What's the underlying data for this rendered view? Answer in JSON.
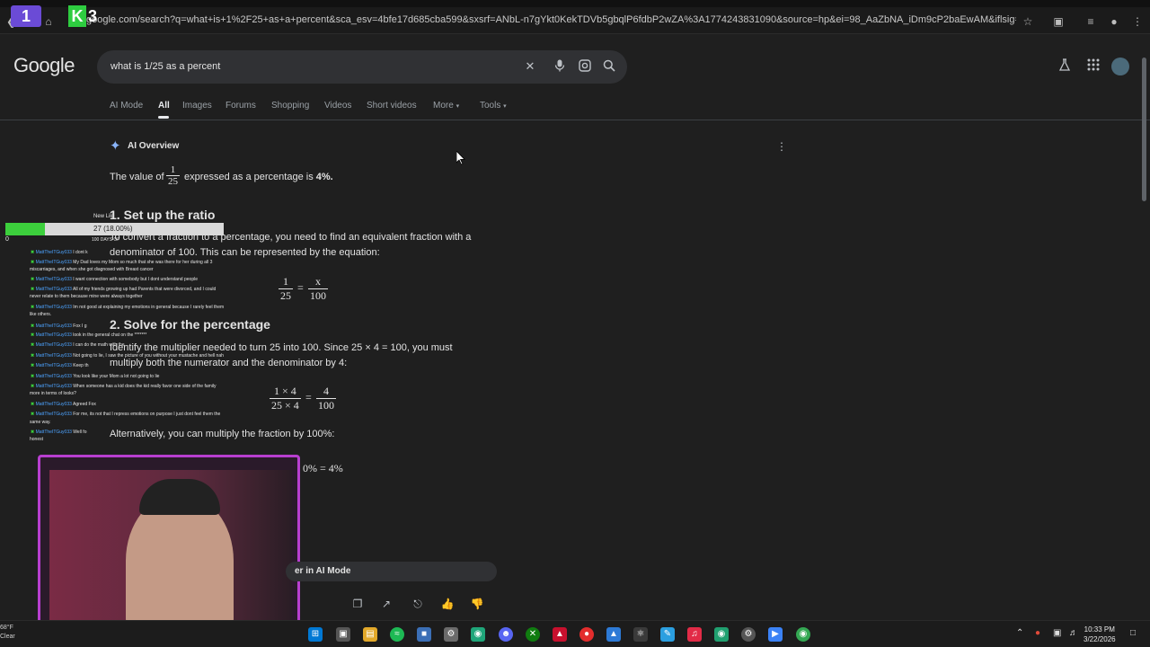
{
  "browser": {
    "url": "google.com/search?q=what+is+1%2F25+as+a+percent&sca_esv=4bfe17d685cba599&sxsrf=ANbL-n7gYkt0KekTDVb5gbqlP6fdbP2wZA%3A1774243831090&source=hp&ei=98_AaZbNA_iDm9cP2baEwAM&iflsig=AFdpzrgAAAAAacDeB4jg3VN..."
  },
  "overlay": {
    "badge_one": "1",
    "badge_three": "3"
  },
  "google": {
    "logo": "Google",
    "query": "what is 1/25 as a percent",
    "tabs": [
      {
        "label": "AI Mode"
      },
      {
        "label": "All"
      },
      {
        "label": "Images"
      },
      {
        "label": "Forums"
      },
      {
        "label": "Shopping"
      },
      {
        "label": "Videos"
      },
      {
        "label": "Short videos"
      },
      {
        "label": "More"
      },
      {
        "label": "Tools"
      }
    ]
  },
  "ai_overview": {
    "title": "AI Overview",
    "intro_before": "The value of",
    "intro_frac_num": "1",
    "intro_frac_den": "25",
    "intro_after": "expressed as a percentage is",
    "intro_result": "4%.",
    "step1_heading": "1. Set up the ratio",
    "step1_text_a": "To convert a fraction to a percentage, you need to find an equivalent fraction with a",
    "step1_text_b": "denominator of 100. This can be represented by the equation:",
    "eq1_left_num": "1",
    "eq1_left_den": "25",
    "eq1_eq": "=",
    "eq1_right_num": "x",
    "eq1_right_den": "100",
    "step2_heading": "2. Solve for the percentage",
    "step2_text_a": "Identify the multiplier needed to turn 25 into 100. Since 25 × 4 = 100, you must",
    "step2_text_b": "multiply both the numerator and the denominator by 4:",
    "eq2_left_num": "1 × 4",
    "eq2_left_den": "25 × 4",
    "eq2_eq": "=",
    "eq2_right_num": "4",
    "eq2_right_den": "100",
    "alt_text": "Alternatively, you can multiply the fraction by 100%:",
    "alt_eq": "0% = 4%",
    "ai_mode_label": "er in AI Mode"
  },
  "chat": {
    "bar_label_top": "New Lik",
    "bar_value_label": "27 (18.00%)",
    "bar_fraction": 0.18,
    "bar_min": "0",
    "bar_sub": "100 DAYS OF",
    "lines": [
      {
        "user": "MattTheITGuy033",
        "text": "I dont k"
      },
      {
        "user": "MattTheITGuy033",
        "text": "My Dad loves my Mom so much that she was there for her during all 3"
      },
      {
        "user": "",
        "text": "miscarriages, and when she got diagnosed with Breast cancer"
      },
      {
        "user": "MattTheITGuy033",
        "text": "I want connection with somebody but I dont understand people"
      },
      {
        "user": "MattTheITGuy033",
        "text": "All of my friends growing up had Parents that were divorced, and I could"
      },
      {
        "user": "",
        "text": "never relate to them because mine were always together"
      },
      {
        "user": "MattTheITGuy033",
        "text": "Im not good at explaining my emotions in general because I rarely feel them"
      },
      {
        "user": "",
        "text": "like others."
      },
      {
        "user": "MattTheITGuy033",
        "text": "Fox I g"
      },
      {
        "user": "MattTheITGuy033",
        "text": "look in the general chat on the *******"
      },
      {
        "user": "MattTheITGuy033",
        "text": "I can do the math with the"
      },
      {
        "user": "MattTheITGuy033",
        "text": "Not going to lie, I saw the picture of you without your mustache and hell nah"
      },
      {
        "user": "MattTheITGuy033",
        "text": "Keep th"
      },
      {
        "user": "MattTheITGuy033",
        "text": "You look like your Mom a lot not going to lie"
      },
      {
        "user": "MattTheITGuy033",
        "text": "When someone has a kid does the kid really favor one side of the family"
      },
      {
        "user": "",
        "text": "more in terms of looks?"
      },
      {
        "user": "MattTheITGuy033",
        "text": "Agreed Fox"
      },
      {
        "user": "MattTheITGuy033",
        "text": "For me, its not that I repress emotions on purpose I just dont feel them the"
      },
      {
        "user": "",
        "text": "same way."
      },
      {
        "user": "MattTheITGuy033",
        "text": "Well fo"
      },
      {
        "user": "",
        "text": "honest"
      }
    ]
  },
  "taskbar": {
    "weather_temp": "68°F",
    "weather_desc": "Clear",
    "time": "10:33 PM",
    "date": "3/22/2026"
  },
  "colors": {
    "accent": "#8ab4f8",
    "webcam_border": "#b83fd0",
    "chat_green": "#3ccf3c",
    "chat_user": "#4da3ff"
  },
  "icons": [
    "back-icon",
    "home-icon",
    "star-icon",
    "clear-icon",
    "mic-icon",
    "lens-icon",
    "search-icon",
    "labs-icon",
    "apps-icon",
    "profile-icon",
    "sparkle-icon",
    "more-vert-icon",
    "copy-icon",
    "share-icon",
    "thumbs-up-icon",
    "thumbs-down-icon",
    "windows-icon"
  ]
}
